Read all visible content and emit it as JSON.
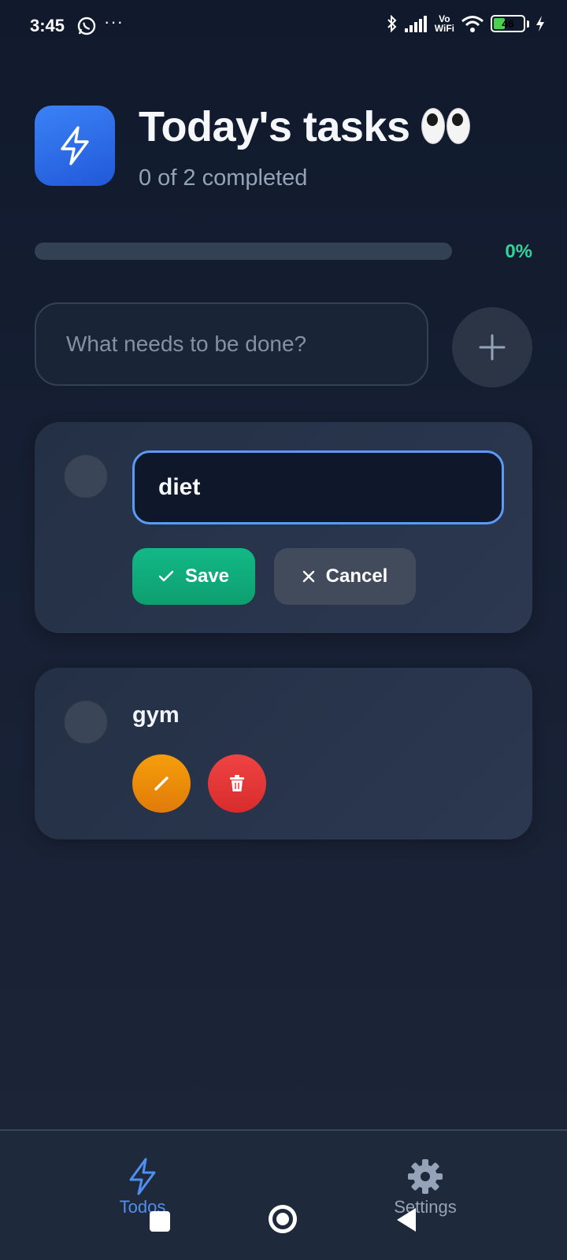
{
  "status_bar": {
    "time": "3:45",
    "dots": "···",
    "network_label_top": "Vo",
    "network_label_bottom": "WiFi",
    "battery": "46",
    "battery_level": 0.46,
    "icons": [
      "whatsapp-icon",
      "bluetooth-icon",
      "signal-icon",
      "wifi-icon",
      "battery-icon",
      "charging-icon"
    ]
  },
  "header": {
    "title": "Today's tasks",
    "title_emoji": "eyes",
    "subtitle": "0 of 2 completed"
  },
  "progress": {
    "value": 0,
    "label": "0%",
    "accent": "#34d399"
  },
  "new_task": {
    "placeholder": "What needs to be done?",
    "value": ""
  },
  "tasks": [
    {
      "text": "diet",
      "completed": false,
      "editing": true,
      "edit_value": "diet",
      "save_label": "Save",
      "cancel_label": "Cancel"
    },
    {
      "text": "gym",
      "completed": false,
      "editing": false
    }
  ],
  "bottom_nav": {
    "items": [
      {
        "label": "Todos",
        "icon": "lightning-icon",
        "active": true
      },
      {
        "label": "Settings",
        "icon": "gear-icon",
        "active": false
      }
    ]
  },
  "colors": {
    "accent": "#3b82f6",
    "save": "#12b886",
    "edit": "#f59e0b",
    "delete": "#ef4444",
    "background": "#111a2d"
  }
}
